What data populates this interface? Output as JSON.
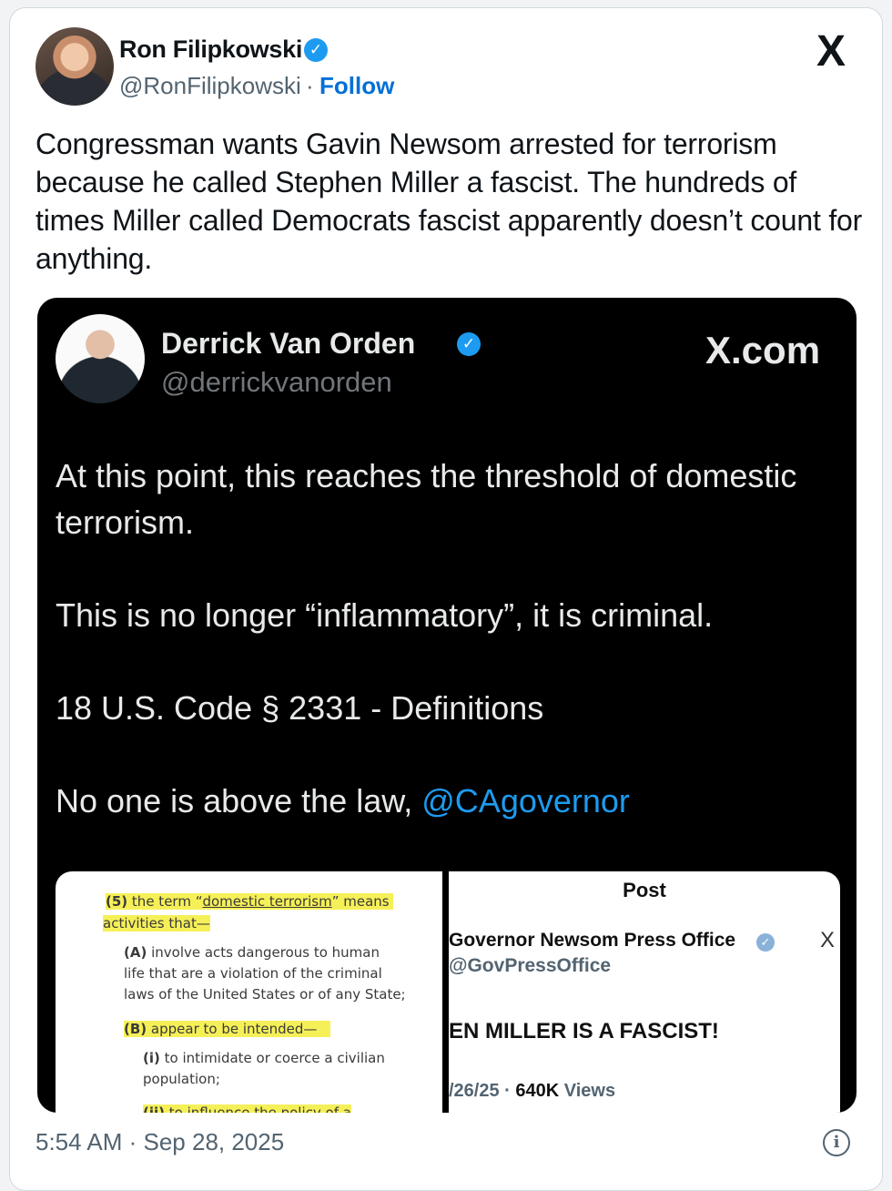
{
  "post": {
    "author_name": "Ron Filipkowski",
    "author_handle": "@RonFilipkowski",
    "separator": "·",
    "follow_label": "Follow",
    "brand_icon": "X",
    "text": "Congressman wants Gavin Newsom arrested for terrorism because he called Stephen Miller a fascist. The hundreds of times Miller called Democrats fascist apparently doesn’t count for anything.",
    "timestamp": "5:54 AM · Sep 28, 2025",
    "verified_color": "#1d9bf0",
    "link_color": "#006fd6"
  },
  "embed": {
    "author_name": "Derrick Van Orden",
    "author_handle": "@derrickvanorden",
    "site_label": "X.com",
    "paragraphs": [
      "At this point, this reaches the threshold of domestic terrorism.",
      "This is no longer “inflammatory”, it is criminal.",
      "18 U.S. Code § 2331 - Definitions"
    ],
    "last_line_text": "No one is above the law, ",
    "last_line_mention": "@CAgovernor",
    "background": "#000000",
    "mention_color": "#1d9bf0"
  },
  "media_left": {
    "line1_num": "(5)",
    "line1_pre": " the term “",
    "line1_term": "domestic terrorism",
    "line1_post": "” means",
    "line2": "activities that—",
    "a_label": "(A)",
    "a_text_1": " involve acts dangerous to human",
    "a_text_2": "life that are a violation of the criminal",
    "a_text_3": "laws of the United States or of any State;",
    "b_label": "(B)",
    "b_text": " appear to be intended—",
    "i_label": "(i)",
    "i_text_1": " to intimidate or coerce a civilian",
    "i_text_2": "population;",
    "ii_label": "(ii)",
    "ii_text": " to influence the policy of a"
  },
  "media_right": {
    "title": "Post",
    "name": "Governor Newsom Press Office",
    "handle": "@GovPressOffice",
    "headline": "EN MILLER IS A FASCIST!",
    "date": "/26/25",
    "views_count": "640K",
    "views_label": "Views",
    "x_glyph": "X"
  }
}
